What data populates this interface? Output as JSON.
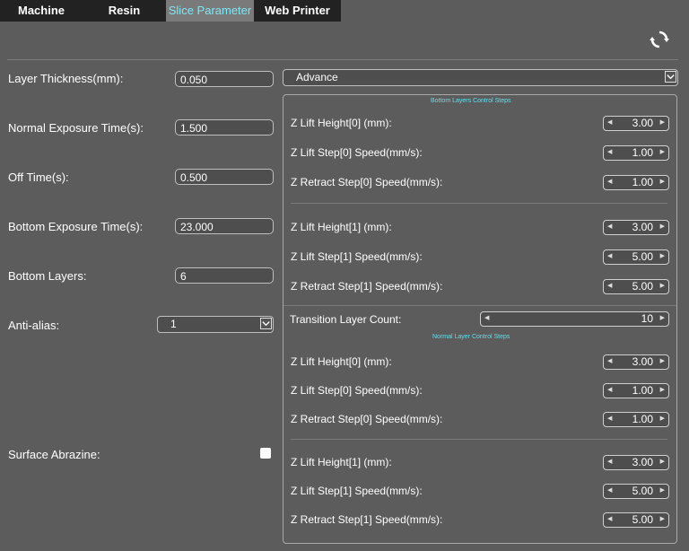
{
  "tabs": [
    {
      "label": "Machine",
      "active": false
    },
    {
      "label": "Resin",
      "active": false
    },
    {
      "label": "Slice Parameter",
      "active": true
    },
    {
      "label": "Web Printer",
      "active": false
    }
  ],
  "icons": {
    "refresh": "refresh-icon",
    "dropdown": "chevron-down-icon"
  },
  "colors": {
    "accent": "#7fe6f5",
    "background": "#5c5c5c",
    "tab_bg": "#222222"
  },
  "left": {
    "layer_thickness": {
      "label": "Layer Thickness(mm):",
      "value": "0.050"
    },
    "normal_exposure": {
      "label": "Normal Exposure Time(s):",
      "value": "1.500"
    },
    "off_time": {
      "label": "Off Time(s):",
      "value": "0.500"
    },
    "bottom_exposure": {
      "label": "Bottom Exposure Time(s):",
      "value": "23.000"
    },
    "bottom_layers": {
      "label": "Bottom Layers:",
      "value": "6"
    },
    "anti_alias": {
      "label": "Anti-alias:",
      "value": "1"
    },
    "surface": {
      "label": "Surface Abrazine:",
      "checked": false
    }
  },
  "right": {
    "mode": "Advance",
    "bottom_section_title": "Bottom Layers Control Steps",
    "bottom_steps": [
      {
        "label": "Z Lift Height[0] (mm):",
        "value": "3.00"
      },
      {
        "label": "Z Lift Step[0] Speed(mm/s):",
        "value": "1.00"
      },
      {
        "label": "Z Retract Step[0] Speed(mm/s):",
        "value": "1.00"
      },
      {
        "label": "Z Lift Height[1] (mm):",
        "value": "3.00"
      },
      {
        "label": "Z Lift Step[1] Speed(mm/s):",
        "value": "5.00"
      },
      {
        "label": "Z Retract Step[1] Speed(mm/s):",
        "value": "5.00"
      }
    ],
    "transition": {
      "label": "Transition Layer Count:",
      "value": "10"
    },
    "normal_section_title": "Normal Layer Control Steps",
    "normal_steps": [
      {
        "label": "Z Lift Height[0] (mm):",
        "value": "3.00"
      },
      {
        "label": "Z Lift Step[0] Speed(mm/s):",
        "value": "1.00"
      },
      {
        "label": "Z Retract Step[0] Speed(mm/s):",
        "value": "1.00"
      },
      {
        "label": "Z Lift Height[1] (mm):",
        "value": "3.00"
      },
      {
        "label": "Z Lift Step[1] Speed(mm/s):",
        "value": "5.00"
      },
      {
        "label": "Z Retract Step[1] Speed(mm/s):",
        "value": "5.00"
      }
    ]
  }
}
